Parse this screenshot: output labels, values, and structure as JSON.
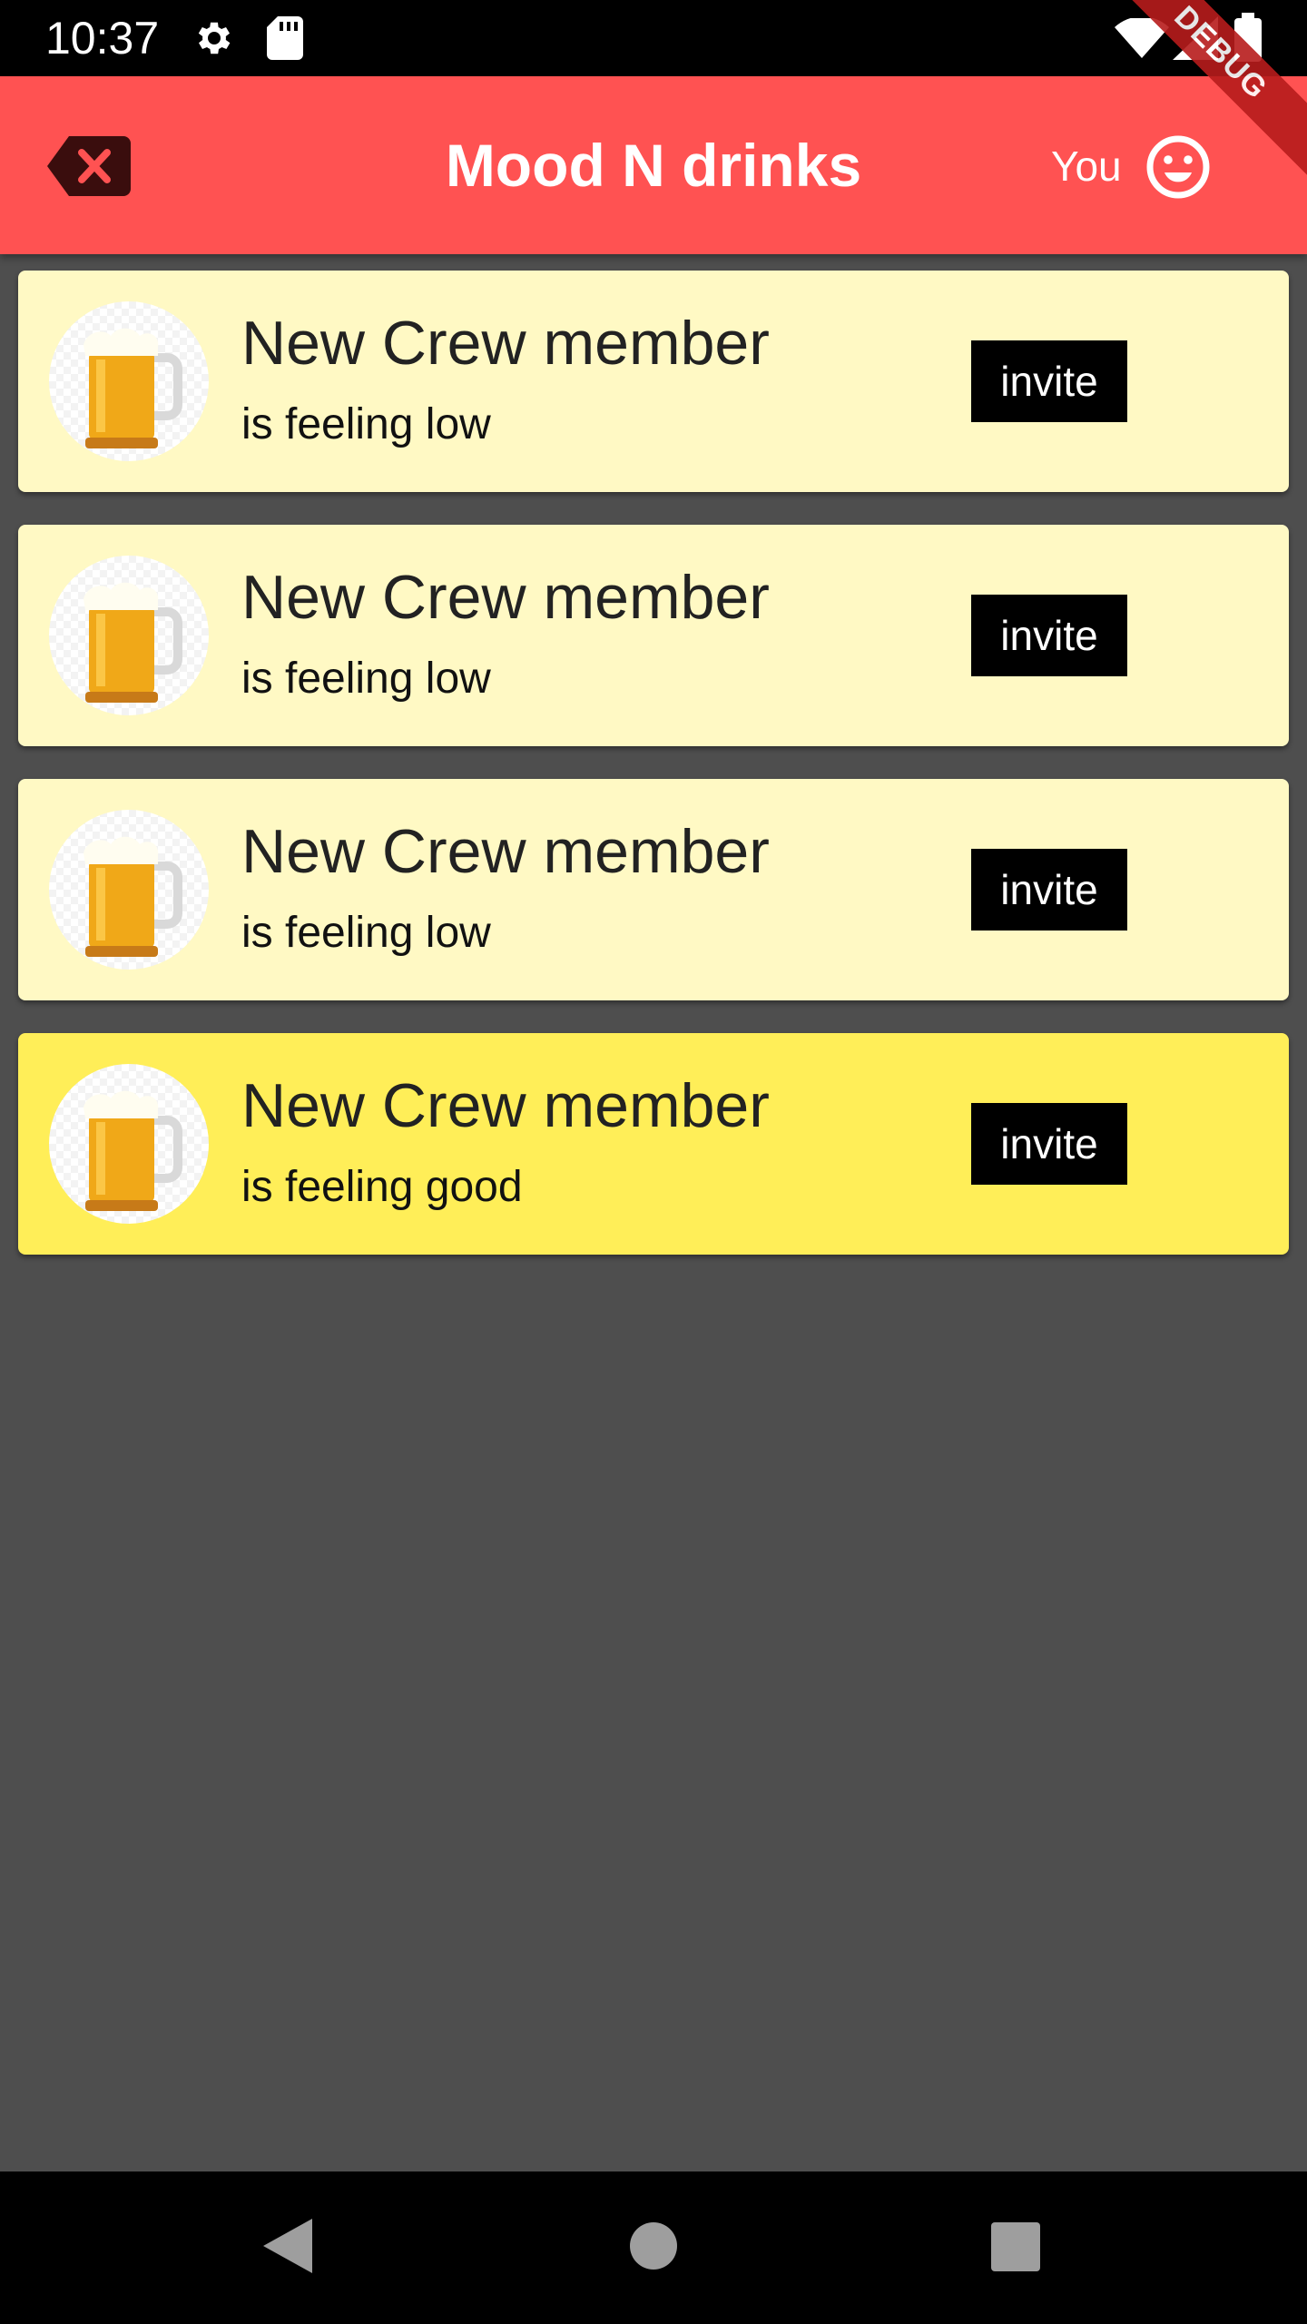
{
  "status_bar": {
    "time": "10:37",
    "icons": [
      "settings-icon",
      "sd-card-icon",
      "wifi-icon",
      "signal-icon",
      "battery-icon"
    ]
  },
  "app_bar": {
    "title": "Mood N drinks",
    "back_icon": "backspace-close-icon",
    "you_label": "You",
    "mood_icon": "smiley-face-icon",
    "debug_label": "DEBUG",
    "background_color": "#ff5252"
  },
  "crew": [
    {
      "name": "New Crew member",
      "status": "is feeling low",
      "action": "invite",
      "avatar": "beer-mug-image",
      "mood": "low"
    },
    {
      "name": "New Crew member",
      "status": "is feeling low",
      "action": "invite",
      "avatar": "beer-mug-image",
      "mood": "low"
    },
    {
      "name": "New Crew member",
      "status": "is feeling low",
      "action": "invite",
      "avatar": "beer-mug-image",
      "mood": "low"
    },
    {
      "name": "New Crew member",
      "status": "is feeling good",
      "action": "invite",
      "avatar": "beer-mug-image",
      "mood": "good"
    }
  ],
  "colors": {
    "card_low": "#fff9c4",
    "card_good": "#ffee58",
    "list_background": "#4e4e4e"
  },
  "nav_bar": {
    "items": [
      "back-triangle-icon",
      "home-circle-icon",
      "recents-square-icon"
    ]
  }
}
